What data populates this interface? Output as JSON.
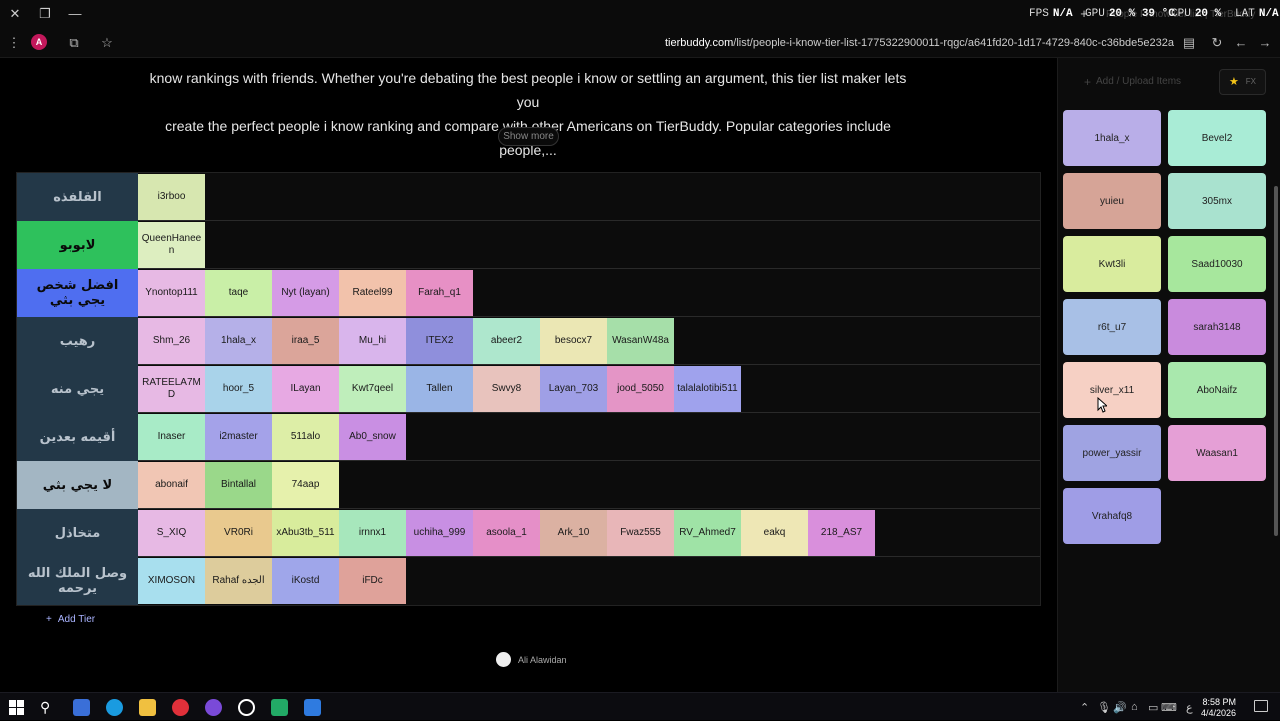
{
  "titlebar": {
    "tab_title": "People I Know tier list | TierBuddy",
    "fps_label": "FPS",
    "fps_value": "N/A",
    "gpu_label": "GPU",
    "gpu_value": "20 % 39 °C",
    "cpu_label": "CPU",
    "cpu_value": "20 %",
    "lat_label": "LAT",
    "lat_value": "N/A",
    "close_icon": "close-icon",
    "restore_icon": "restore-icon",
    "minimize_icon": "minimize-icon"
  },
  "addressbar": {
    "profile_initial": "A",
    "url_domain": "tierbuddy.com",
    "url_path": "/list/people-i-know-tier-list-1775322900011-rqgc/a641fd20-1d17-4729-840c-c36bde5e232a"
  },
  "description": {
    "line1": "know rankings with friends. Whether you're debating the best people i know or settling an argument, this tier list maker lets you",
    "line2": "create the perfect people i know ranking and compare with other Americans on TierBuddy. Popular categories include people,...",
    "show_more": "Show more"
  },
  "tiers": [
    {
      "label": "القلفذه",
      "color": "#233848",
      "text_color": "#b8c2cc",
      "items": [
        {
          "name": "i3rboo",
          "color": "#d7e7b0"
        }
      ]
    },
    {
      "label": "لابوبو",
      "color": "#2ec15c",
      "text_color": "#0a0a0a",
      "items": [
        {
          "name": "QueenHaneen",
          "color": "#ddeec0"
        }
      ]
    },
    {
      "label": "افضل شخص يجي بثي",
      "color": "#4f6ef0",
      "text_color": "#0a0a0a",
      "items": [
        {
          "name": "Ynontop111",
          "color": "#e7b9e4"
        },
        {
          "name": "taqe",
          "color": "#c9efa7"
        },
        {
          "name": "Nyt (layan)",
          "color": "#d59be6"
        },
        {
          "name": "Rateel99",
          "color": "#f2c2ab"
        },
        {
          "name": "Farah_q1",
          "color": "#e790c5"
        }
      ]
    },
    {
      "label": "رهيب",
      "color": "#233848",
      "text_color": "#b8c2cc",
      "items": [
        {
          "name": "Shm_26",
          "color": "#e7b9e4"
        },
        {
          "name": "1hala_x",
          "color": "#b5b0e8"
        },
        {
          "name": "iraa_5",
          "color": "#dba59a"
        },
        {
          "name": "Mu_hi",
          "color": "#d9b5ec"
        },
        {
          "name": "ITEX2",
          "color": "#8f8fdc"
        },
        {
          "name": "abeer2",
          "color": "#aee7cd"
        },
        {
          "name": "besocx7",
          "color": "#ebe7b4"
        },
        {
          "name": "WasanW48a",
          "color": "#a6dfa9"
        }
      ]
    },
    {
      "label": "يجي منه",
      "color": "#233848",
      "text_color": "#b8c2cc",
      "items": [
        {
          "name": "RATEELA7MD",
          "color": "#e7b9e4"
        },
        {
          "name": "hoor_5",
          "color": "#a9d3ea"
        },
        {
          "name": "ILayan",
          "color": "#e7a9e3"
        },
        {
          "name": "Kwt7qeel",
          "color": "#bfeebb"
        },
        {
          "name": "Tallen",
          "color": "#9ab5e6"
        },
        {
          "name": "Swvy8",
          "color": "#e8c3bd"
        },
        {
          "name": "Layan_703",
          "color": "#9f9fe6"
        },
        {
          "name": "jood_5050",
          "color": "#e495c6"
        },
        {
          "name": "talalalotibi511",
          "color": "#9fa2ed"
        }
      ]
    },
    {
      "label": "أقيمه بعدين",
      "color": "#233848",
      "text_color": "#b8c2cc",
      "items": [
        {
          "name": "Inaser",
          "color": "#a8ebc7"
        },
        {
          "name": "i2master",
          "color": "#a4a2e9"
        },
        {
          "name": "511alo",
          "color": "#ddeea7"
        },
        {
          "name": "Ab0_snow",
          "color": "#c98fe3"
        }
      ]
    },
    {
      "label": "لا يجي بثي",
      "color": "#a3b6c3",
      "text_color": "#0a0a0a",
      "items": [
        {
          "name": "abonaif",
          "color": "#f1c6b4"
        },
        {
          "name": "Bintallal",
          "color": "#9ad88a"
        },
        {
          "name": "74aap",
          "color": "#e6f1ac"
        }
      ]
    },
    {
      "label": "متخاذل",
      "color": "#233848",
      "text_color": "#b8c2cc",
      "items": [
        {
          "name": "S_XIQ",
          "color": "#e7b9e4"
        },
        {
          "name": "VR0Ri",
          "color": "#e9c98e"
        },
        {
          "name": "xAbu3tb_511",
          "color": "#d8ec9c"
        },
        {
          "name": "irnnx1",
          "color": "#a7e7bc"
        },
        {
          "name": "uchiha_999",
          "color": "#c88fe3"
        },
        {
          "name": "asoola_1",
          "color": "#e58fc8"
        },
        {
          "name": "Ark_10",
          "color": "#dbb1a2"
        },
        {
          "name": "Fwaz555",
          "color": "#e8b6b8"
        },
        {
          "name": "RV_Ahmed7",
          "color": "#9fe3a6"
        },
        {
          "name": "eakq",
          "color": "#eee7b5"
        },
        {
          "name": "218_AS7",
          "color": "#d98fdc"
        }
      ]
    },
    {
      "label": "وصل الملك الله يرحمه",
      "color": "#233848",
      "text_color": "#b8c2cc",
      "items": [
        {
          "name": "XIMOSON",
          "color": "#a8dfee"
        },
        {
          "name": "Rahaf الجده",
          "color": "#ddcc9c"
        },
        {
          "name": "iKostd",
          "color": "#9fa6ea"
        },
        {
          "name": "iFDc",
          "color": "#dfa29a"
        }
      ]
    }
  ],
  "add_tier": "Add Tier",
  "author": "Ali Alawidan",
  "sidepanel": {
    "upload_placeholder": "Add / Upload Items",
    "fx_label": "FX",
    "items": [
      {
        "name": "1hala_x",
        "color": "#b9aee8"
      },
      {
        "name": "Bevel2",
        "color": "#a9ecd6"
      },
      {
        "name": "yuieu",
        "color": "#d6a497"
      },
      {
        "name": "305mx",
        "color": "#a9e2cf"
      },
      {
        "name": "Kwt3li",
        "color": "#d9ec9e"
      },
      {
        "name": "Saad10030",
        "color": "#a7e79d"
      },
      {
        "name": "r6t_u7",
        "color": "#a8c0e6"
      },
      {
        "name": "sarah3148",
        "color": "#c98bdd"
      },
      {
        "name": "silver_x11",
        "color": "#f6d0c4"
      },
      {
        "name": "AboNaifz",
        "color": "#a9e8ad"
      },
      {
        "name": "power_yassir",
        "color": "#9fa3e2"
      },
      {
        "name": "Waasan1",
        "color": "#e59fd6"
      },
      {
        "name": "Vrahafq8",
        "color": "#9f9de6"
      }
    ]
  },
  "taskbar": {
    "time": "8:58 PM",
    "date": "4/4/2026",
    "lang": "ع"
  }
}
